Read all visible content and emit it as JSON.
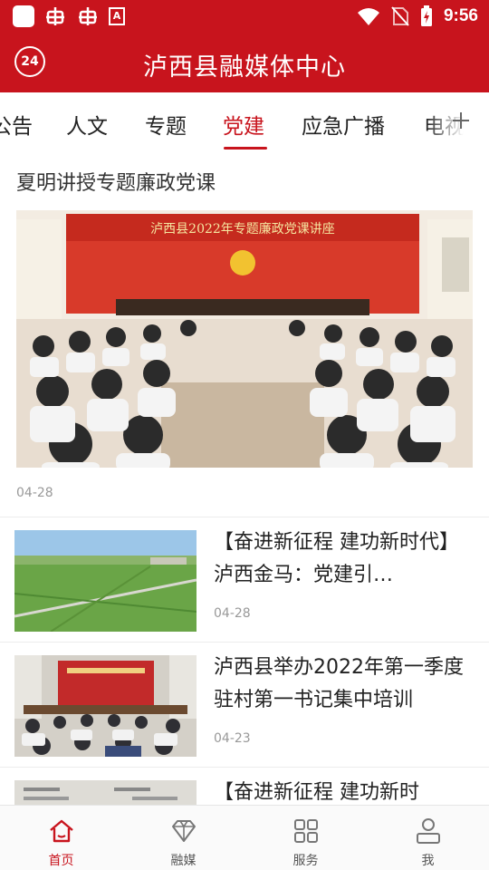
{
  "status_bar": {
    "time": "9:56",
    "icons": [
      "app-square-icon",
      "bug-icon",
      "bug-icon",
      "text-a-icon",
      "wifi-icon",
      "no-sim-icon",
      "battery-charging-icon"
    ]
  },
  "header": {
    "logo": "24",
    "title": "泸西县融媒体中心"
  },
  "tabs": [
    {
      "label": "公告",
      "active": false
    },
    {
      "label": "人文",
      "active": false
    },
    {
      "label": "专题",
      "active": false
    },
    {
      "label": "党建",
      "active": true
    },
    {
      "label": "应急广播",
      "active": false
    },
    {
      "label": "电视",
      "active": false
    }
  ],
  "feature": {
    "title": "夏明讲授专题廉政党课",
    "banner_text": "泸西县2022年专题廉政党课讲座",
    "date": "04-28"
  },
  "articles": [
    {
      "title": "【奋进新征程 建功新时代】泸西金马：党建引…",
      "date": "04-28",
      "thumb": "landscape-fields"
    },
    {
      "title": "泸西县举办2022年第一季度驻村第一书记集中培训",
      "date": "04-23",
      "thumb": "meeting-room"
    },
    {
      "title": "【奋进新征程 建功新时",
      "date": "",
      "thumb": "meeting-hall"
    }
  ],
  "bottom_nav": [
    {
      "label": "首页",
      "icon": "home-icon",
      "active": true
    },
    {
      "label": "融媒",
      "icon": "diamond-icon",
      "active": false
    },
    {
      "label": "服务",
      "icon": "grid-icon",
      "active": false
    },
    {
      "label": "我",
      "icon": "user-icon",
      "active": false
    }
  ],
  "colors": {
    "brand_red": "#c8141d",
    "muted_text": "#999999"
  }
}
